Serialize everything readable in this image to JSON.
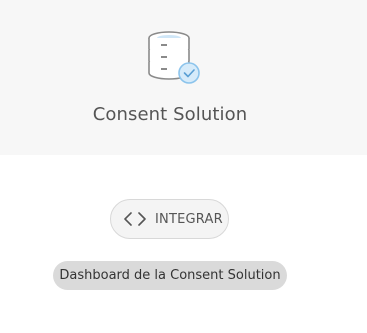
{
  "header": {
    "title": "Consent Solution",
    "icon": "database-check-icon"
  },
  "actions": {
    "integrate_label": "INTEGRAR",
    "integrate_icon": "code-icon",
    "dashboard_label": "Dashboard de la Consent Solution"
  },
  "colors": {
    "header_bg": "#f7f7f7",
    "accent_blue": "#8cc4ec",
    "text_dark": "#555555",
    "pill_bg": "#dadada"
  }
}
